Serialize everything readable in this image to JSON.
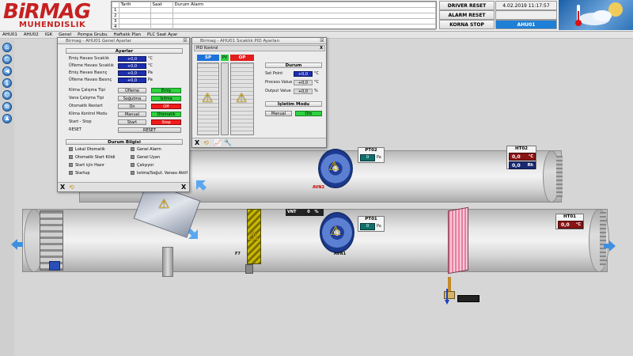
{
  "header": {
    "logo_text": "BiRMAG",
    "logo_sub": "MUHENDISLIK",
    "alarm_table": {
      "columns": [
        "",
        "Tarih",
        "Saat",
        "Durum Alarm"
      ],
      "rows": [
        "1",
        "2",
        "3",
        "4"
      ]
    },
    "driver_reset": "DRIVER RESET",
    "alarm_reset": "ALARM RESET",
    "korna_stop": "KORNA STOP",
    "datetime": "4.02.2019 11:17:57",
    "unit_name": "AHU01"
  },
  "menu": [
    "AHU01",
    "AHU02",
    "IGK",
    "Genel",
    "Pompa Grubu",
    "Haftalık Plan",
    "PLC Saat Ayar"
  ],
  "settings_window": {
    "title": "Birmag - AHU01 Genel Ayarlar",
    "section_title": "Ayarlar",
    "rows": [
      {
        "label": "Emiş Havası Sıcaklık",
        "value": "+0,0",
        "unit": "°C"
      },
      {
        "label": "Üfleme Havası Sıcaklık",
        "value": "+0,0",
        "unit": "°C"
      },
      {
        "label": "Emiş Havası Basınç",
        "value": "+0,0",
        "unit": "Pa"
      },
      {
        "label": "Üfleme Havası Basınç",
        "value": "+0,0",
        "unit": "Pa"
      }
    ],
    "modes": [
      {
        "label": "Klima Çalışma Tipi",
        "button": "Üfleme",
        "state": "Emiş",
        "state_color": "green"
      },
      {
        "label": "Vana Çalışma Tipi",
        "button": "Soğutma",
        "state": "Isıtma",
        "state_color": "green"
      },
      {
        "label": "Otomatik Restart",
        "button": "On",
        "state": "Off",
        "state_color": "red"
      },
      {
        "label": "Klima Kontrol Modu",
        "button": "Manual",
        "state": "Otomatik",
        "state_color": "green"
      },
      {
        "label": "Start - Stop",
        "button": "Start",
        "state": "Stop",
        "state_color": "red"
      }
    ],
    "reset_label": "RESET",
    "reset_button": "RESET",
    "status_title": "Durum Bilgisi",
    "status_left": [
      "Lokal Otomatik",
      "Otomatik Start Kilidi",
      "Start için Hazır",
      "Startup"
    ],
    "status_right": [
      "Genel Alarm",
      "Genel Uyarı",
      "Çalışıyor",
      "Isıtma/Soğut. Vanası Aktif"
    ],
    "close_x": "X"
  },
  "pid_window": {
    "title": "Birmag - AHU01 Sıcaklık PID Ayarları",
    "inner_title": "PID Kontrol",
    "sp_label": "SP",
    "pv_label": "PV",
    "op_label": "OP",
    "status_title": "Durum",
    "setpoint_label": "Set Point",
    "setpoint_value": "+0,0",
    "setpoint_unit": "°C",
    "process_label": "Process Value",
    "process_value": "+0,0",
    "process_unit": "°C",
    "output_label": "Output Value",
    "output_value": "+0,0",
    "output_unit": "%",
    "mode_title": "İşletim Modu",
    "manual_button": "Manual",
    "oto_button": "Oto",
    "close_x": "X"
  },
  "sensors": {
    "pt02": {
      "name": "PT02",
      "value": "0",
      "unit": "Pa"
    },
    "pt01": {
      "name": "PT01",
      "value": "0",
      "unit": "Pa"
    },
    "ht02": {
      "name": "HT02",
      "temp": "0,0",
      "temp_unit": "°C",
      "rh": "0,0",
      "rh_unit": "Rh"
    },
    "ht01": {
      "name": "HT01",
      "temp": "0,0",
      "temp_unit": "°C"
    },
    "vnt": {
      "label": "VNT",
      "value": "0",
      "unit": "%"
    },
    "avn1": "AVN1",
    "avn2": "AVN2",
    "filter": "F7"
  }
}
